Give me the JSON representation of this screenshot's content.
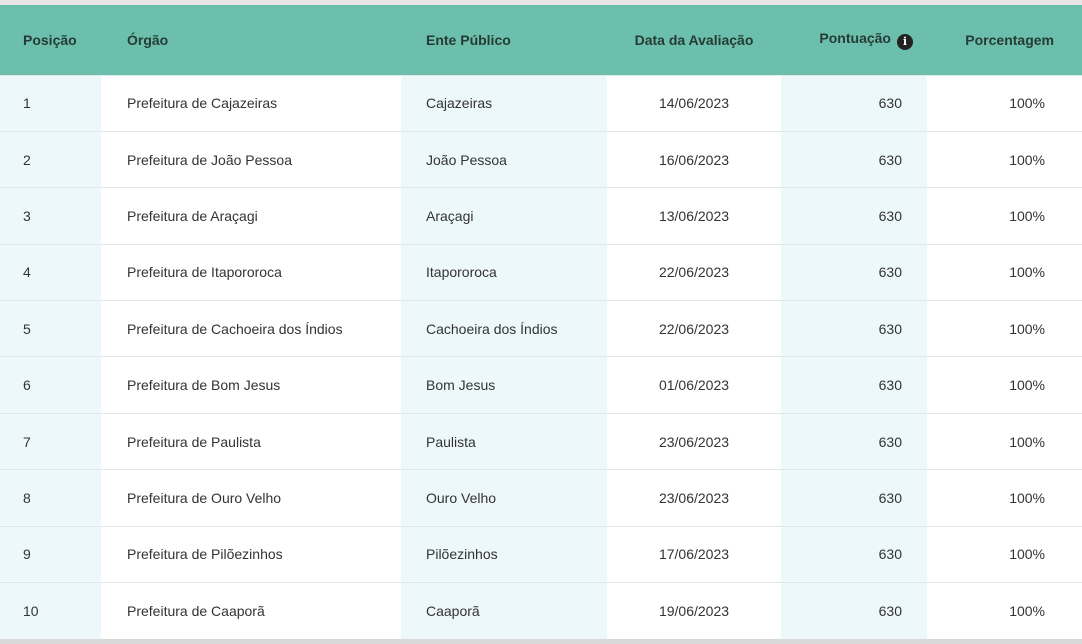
{
  "table": {
    "headers": {
      "posicao": "Posição",
      "orgao": "Órgão",
      "ente": "Ente Público",
      "data": "Data da Avaliação",
      "pontuacao": "Pontuação",
      "porcentagem": "Porcentagem"
    },
    "info_icon": "info-icon",
    "rows": [
      {
        "pos": "1",
        "orgao": "Prefeitura de Cajazeiras",
        "ente": "Cajazeiras",
        "data": "14/06/2023",
        "pontuacao": "630",
        "porcentagem": "100%"
      },
      {
        "pos": "2",
        "orgao": "Prefeitura de João Pessoa",
        "ente": "João Pessoa",
        "data": "16/06/2023",
        "pontuacao": "630",
        "porcentagem": "100%"
      },
      {
        "pos": "3",
        "orgao": "Prefeitura de Araçagi",
        "ente": "Araçagi",
        "data": "13/06/2023",
        "pontuacao": "630",
        "porcentagem": "100%"
      },
      {
        "pos": "4",
        "orgao": "Prefeitura de Itapororoca",
        "ente": "Itapororoca",
        "data": "22/06/2023",
        "pontuacao": "630",
        "porcentagem": "100%"
      },
      {
        "pos": "5",
        "orgao": "Prefeitura de Cachoeira dos Índios",
        "ente": "Cachoeira dos Índios",
        "data": "22/06/2023",
        "pontuacao": "630",
        "porcentagem": "100%"
      },
      {
        "pos": "6",
        "orgao": "Prefeitura de Bom Jesus",
        "ente": "Bom Jesus",
        "data": "01/06/2023",
        "pontuacao": "630",
        "porcentagem": "100%"
      },
      {
        "pos": "7",
        "orgao": "Prefeitura de Paulista",
        "ente": "Paulista",
        "data": "23/06/2023",
        "pontuacao": "630",
        "porcentagem": "100%"
      },
      {
        "pos": "8",
        "orgao": "Prefeitura de Ouro Velho",
        "ente": "Ouro Velho",
        "data": "23/06/2023",
        "pontuacao": "630",
        "porcentagem": "100%"
      },
      {
        "pos": "9",
        "orgao": "Prefeitura de Pilõezinhos",
        "ente": "Pilõezinhos",
        "data": "17/06/2023",
        "pontuacao": "630",
        "porcentagem": "100%"
      },
      {
        "pos": "10",
        "orgao": "Prefeitura de Caaporã",
        "ente": "Caaporã",
        "data": "19/06/2023",
        "pontuacao": "630",
        "porcentagem": "100%"
      }
    ]
  },
  "colors": {
    "header_bg": "#6cbfac",
    "header_text": "#263b35",
    "shaded_column": "#edf8fa",
    "row_border": "#dfe9e7"
  }
}
